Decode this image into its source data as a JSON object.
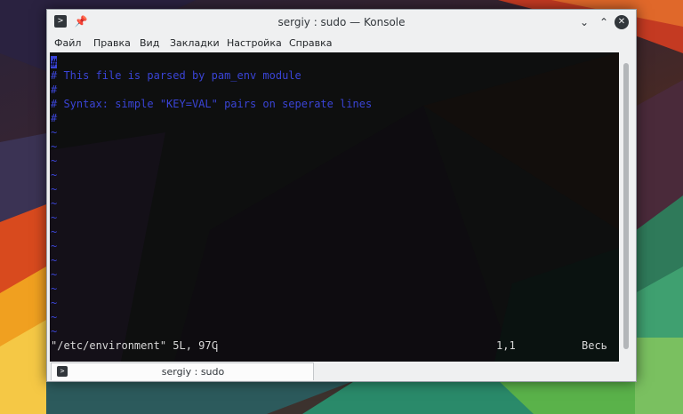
{
  "window": {
    "title": "sergiy : sudo — Konsole",
    "icons": {
      "app": "terminal-icon",
      "pin": "pin-icon",
      "minimize": "chevron-down-icon",
      "maximize": "chevron-up-icon",
      "close": "close-icon"
    }
  },
  "menubar": {
    "items": [
      "Файл",
      "Правка",
      "Вид",
      "Закладки",
      "Настройка",
      "Справка"
    ]
  },
  "terminal": {
    "cursor_char": "#",
    "lines": [
      "# This file is parsed by pam_env module",
      "#",
      "# Syntax: simple \"KEY=VAL\" pairs on seperate lines",
      "#"
    ],
    "tilde": "~",
    "status_file": "\"/etc/environment\" 5L, 97C",
    "status_position": "1,1",
    "status_all": "Весь",
    "colors": {
      "comment": "#3a44d6",
      "status": "#d8d8d8",
      "background": "#000000"
    }
  },
  "tabs": [
    {
      "label": "sergiy : sudo",
      "active": true
    }
  ]
}
